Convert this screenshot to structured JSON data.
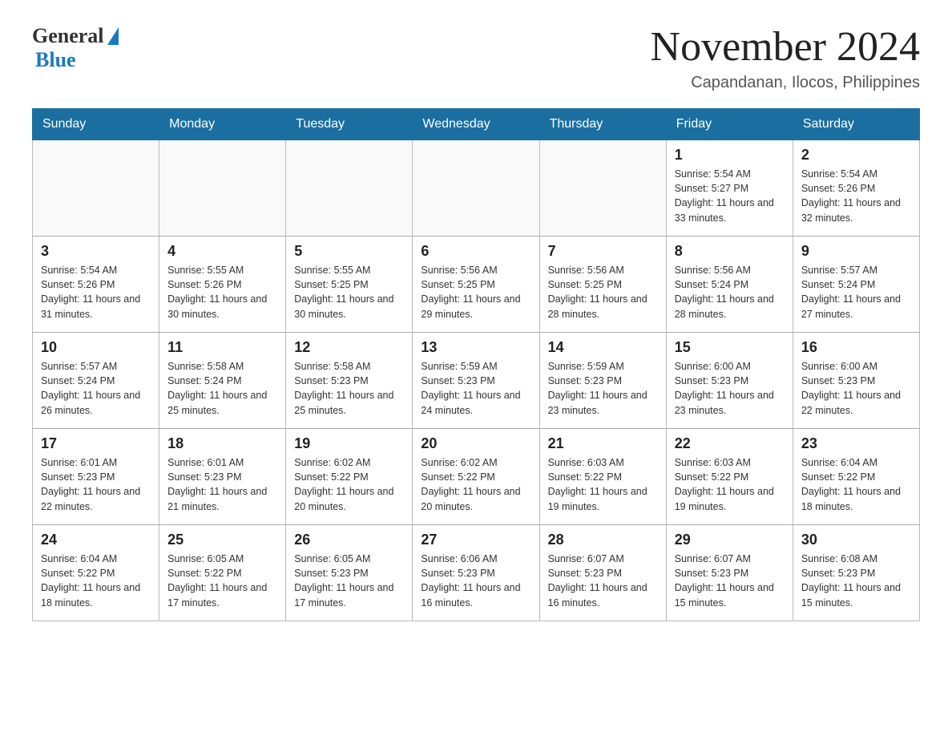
{
  "header": {
    "logo_general": "General",
    "logo_blue": "Blue",
    "main_title": "November 2024",
    "subtitle": "Capandanan, Ilocos, Philippines"
  },
  "days_of_week": [
    "Sunday",
    "Monday",
    "Tuesday",
    "Wednesday",
    "Thursday",
    "Friday",
    "Saturday"
  ],
  "weeks": [
    [
      {
        "day": "",
        "info": ""
      },
      {
        "day": "",
        "info": ""
      },
      {
        "day": "",
        "info": ""
      },
      {
        "day": "",
        "info": ""
      },
      {
        "day": "",
        "info": ""
      },
      {
        "day": "1",
        "info": "Sunrise: 5:54 AM\nSunset: 5:27 PM\nDaylight: 11 hours\nand 33 minutes."
      },
      {
        "day": "2",
        "info": "Sunrise: 5:54 AM\nSunset: 5:26 PM\nDaylight: 11 hours\nand 32 minutes."
      }
    ],
    [
      {
        "day": "3",
        "info": "Sunrise: 5:54 AM\nSunset: 5:26 PM\nDaylight: 11 hours\nand 31 minutes."
      },
      {
        "day": "4",
        "info": "Sunrise: 5:55 AM\nSunset: 5:26 PM\nDaylight: 11 hours\nand 30 minutes."
      },
      {
        "day": "5",
        "info": "Sunrise: 5:55 AM\nSunset: 5:25 PM\nDaylight: 11 hours\nand 30 minutes."
      },
      {
        "day": "6",
        "info": "Sunrise: 5:56 AM\nSunset: 5:25 PM\nDaylight: 11 hours\nand 29 minutes."
      },
      {
        "day": "7",
        "info": "Sunrise: 5:56 AM\nSunset: 5:25 PM\nDaylight: 11 hours\nand 28 minutes."
      },
      {
        "day": "8",
        "info": "Sunrise: 5:56 AM\nSunset: 5:24 PM\nDaylight: 11 hours\nand 28 minutes."
      },
      {
        "day": "9",
        "info": "Sunrise: 5:57 AM\nSunset: 5:24 PM\nDaylight: 11 hours\nand 27 minutes."
      }
    ],
    [
      {
        "day": "10",
        "info": "Sunrise: 5:57 AM\nSunset: 5:24 PM\nDaylight: 11 hours\nand 26 minutes."
      },
      {
        "day": "11",
        "info": "Sunrise: 5:58 AM\nSunset: 5:24 PM\nDaylight: 11 hours\nand 25 minutes."
      },
      {
        "day": "12",
        "info": "Sunrise: 5:58 AM\nSunset: 5:23 PM\nDaylight: 11 hours\nand 25 minutes."
      },
      {
        "day": "13",
        "info": "Sunrise: 5:59 AM\nSunset: 5:23 PM\nDaylight: 11 hours\nand 24 minutes."
      },
      {
        "day": "14",
        "info": "Sunrise: 5:59 AM\nSunset: 5:23 PM\nDaylight: 11 hours\nand 23 minutes."
      },
      {
        "day": "15",
        "info": "Sunrise: 6:00 AM\nSunset: 5:23 PM\nDaylight: 11 hours\nand 23 minutes."
      },
      {
        "day": "16",
        "info": "Sunrise: 6:00 AM\nSunset: 5:23 PM\nDaylight: 11 hours\nand 22 minutes."
      }
    ],
    [
      {
        "day": "17",
        "info": "Sunrise: 6:01 AM\nSunset: 5:23 PM\nDaylight: 11 hours\nand 22 minutes."
      },
      {
        "day": "18",
        "info": "Sunrise: 6:01 AM\nSunset: 5:23 PM\nDaylight: 11 hours\nand 21 minutes."
      },
      {
        "day": "19",
        "info": "Sunrise: 6:02 AM\nSunset: 5:22 PM\nDaylight: 11 hours\nand 20 minutes."
      },
      {
        "day": "20",
        "info": "Sunrise: 6:02 AM\nSunset: 5:22 PM\nDaylight: 11 hours\nand 20 minutes."
      },
      {
        "day": "21",
        "info": "Sunrise: 6:03 AM\nSunset: 5:22 PM\nDaylight: 11 hours\nand 19 minutes."
      },
      {
        "day": "22",
        "info": "Sunrise: 6:03 AM\nSunset: 5:22 PM\nDaylight: 11 hours\nand 19 minutes."
      },
      {
        "day": "23",
        "info": "Sunrise: 6:04 AM\nSunset: 5:22 PM\nDaylight: 11 hours\nand 18 minutes."
      }
    ],
    [
      {
        "day": "24",
        "info": "Sunrise: 6:04 AM\nSunset: 5:22 PM\nDaylight: 11 hours\nand 18 minutes."
      },
      {
        "day": "25",
        "info": "Sunrise: 6:05 AM\nSunset: 5:22 PM\nDaylight: 11 hours\nand 17 minutes."
      },
      {
        "day": "26",
        "info": "Sunrise: 6:05 AM\nSunset: 5:23 PM\nDaylight: 11 hours\nand 17 minutes."
      },
      {
        "day": "27",
        "info": "Sunrise: 6:06 AM\nSunset: 5:23 PM\nDaylight: 11 hours\nand 16 minutes."
      },
      {
        "day": "28",
        "info": "Sunrise: 6:07 AM\nSunset: 5:23 PM\nDaylight: 11 hours\nand 16 minutes."
      },
      {
        "day": "29",
        "info": "Sunrise: 6:07 AM\nSunset: 5:23 PM\nDaylight: 11 hours\nand 15 minutes."
      },
      {
        "day": "30",
        "info": "Sunrise: 6:08 AM\nSunset: 5:23 PM\nDaylight: 11 hours\nand 15 minutes."
      }
    ]
  ]
}
